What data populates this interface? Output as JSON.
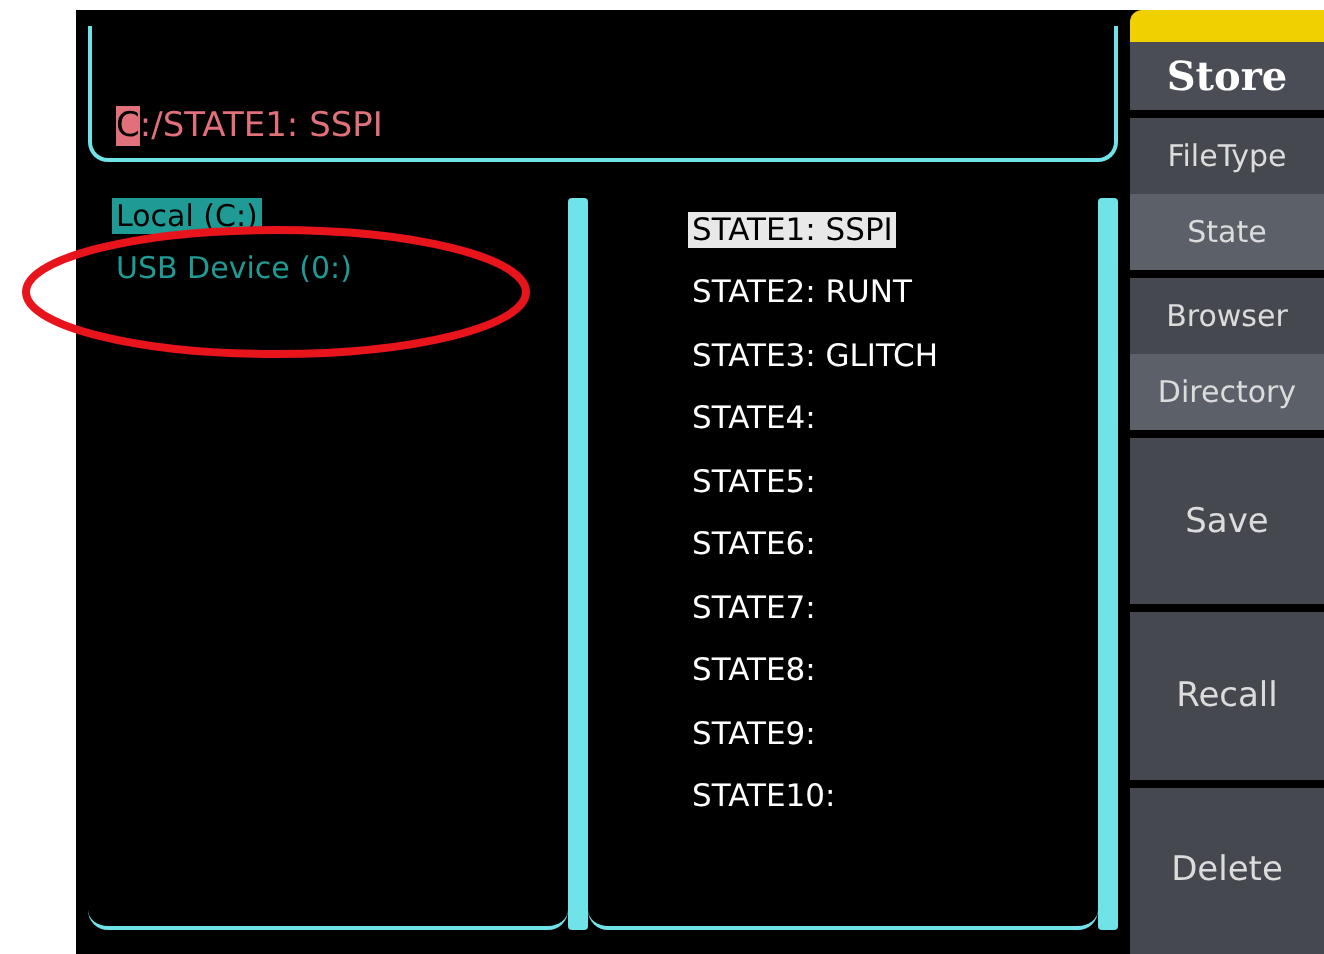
{
  "path": {
    "cursor": "C",
    "rest": ":/STATE1: SSPI"
  },
  "drives": [
    {
      "label": "Local (C:)",
      "selected": true
    },
    {
      "label": "USB Device (0:)",
      "selected": false
    }
  ],
  "files": [
    {
      "label": "STATE1: SSPI",
      "selected": true
    },
    {
      "label": "STATE2: RUNT",
      "selected": false
    },
    {
      "label": "STATE3: GLITCH",
      "selected": false
    },
    {
      "label": "STATE4:",
      "selected": false
    },
    {
      "label": "STATE5:",
      "selected": false
    },
    {
      "label": "STATE6:",
      "selected": false
    },
    {
      "label": "STATE7:",
      "selected": false
    },
    {
      "label": "STATE8:",
      "selected": false
    },
    {
      "label": "STATE9:",
      "selected": false
    },
    {
      "label": "STATE10:",
      "selected": false
    }
  ],
  "menu": {
    "title": "Store",
    "items": [
      {
        "kind": "option",
        "label": "FileType",
        "value": "State"
      },
      {
        "kind": "option",
        "label": "Browser",
        "value": "Directory"
      },
      {
        "kind": "button",
        "label": "Save"
      },
      {
        "kind": "button",
        "label": "Recall"
      },
      {
        "kind": "button",
        "label": "Delete"
      }
    ]
  }
}
